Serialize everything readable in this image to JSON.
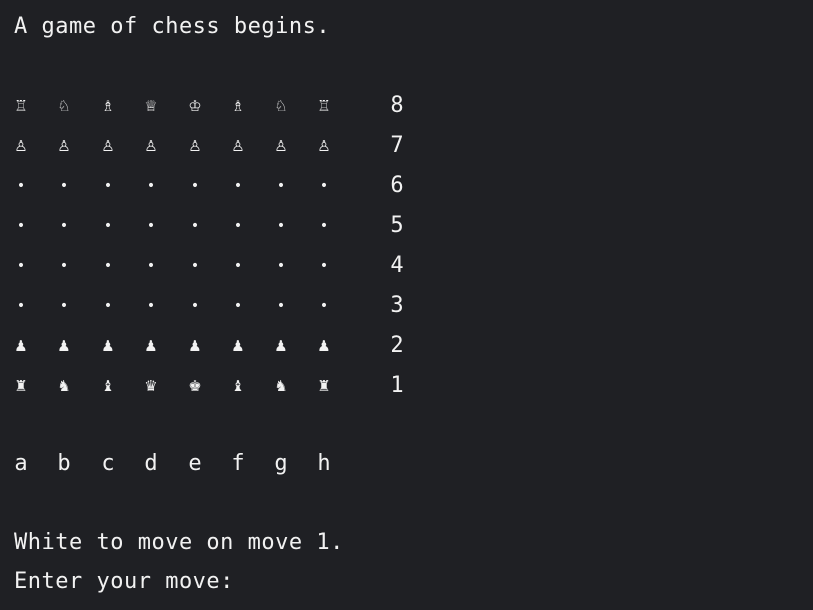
{
  "terminal": {
    "title_line": "A game of chess begins.",
    "status_line": "White to move on move 1.",
    "prompt": "Enter your move:"
  },
  "board": {
    "ranks": [
      {
        "label": "8",
        "squares": [
          "♖",
          "♘",
          "♗",
          "♕",
          "♔",
          "♗",
          "♘",
          "♖"
        ]
      },
      {
        "label": "7",
        "squares": [
          "♙",
          "♙",
          "♙",
          "♙",
          "♙",
          "♙",
          "♙",
          "♙"
        ]
      },
      {
        "label": "6",
        "squares": [
          "•",
          "•",
          "•",
          "•",
          "•",
          "•",
          "•",
          "•"
        ]
      },
      {
        "label": "5",
        "squares": [
          "•",
          "•",
          "•",
          "•",
          "•",
          "•",
          "•",
          "•"
        ]
      },
      {
        "label": "4",
        "squares": [
          "•",
          "•",
          "•",
          "•",
          "•",
          "•",
          "•",
          "•"
        ]
      },
      {
        "label": "3",
        "squares": [
          "•",
          "•",
          "•",
          "•",
          "•",
          "•",
          "•",
          "•"
        ]
      },
      {
        "label": "2",
        "squares": [
          "♟",
          "♟",
          "♟",
          "♟",
          "♟",
          "♟",
          "♟",
          "♟"
        ]
      },
      {
        "label": "1",
        "squares": [
          "♜",
          "♞",
          "♝",
          "♛",
          "♚",
          "♝",
          "♞",
          "♜"
        ]
      }
    ],
    "files": [
      "a",
      "b",
      "c",
      "d",
      "e",
      "f",
      "g",
      "h"
    ]
  },
  "colors": {
    "background": "#1f2024",
    "text": "#f2f2f2"
  }
}
